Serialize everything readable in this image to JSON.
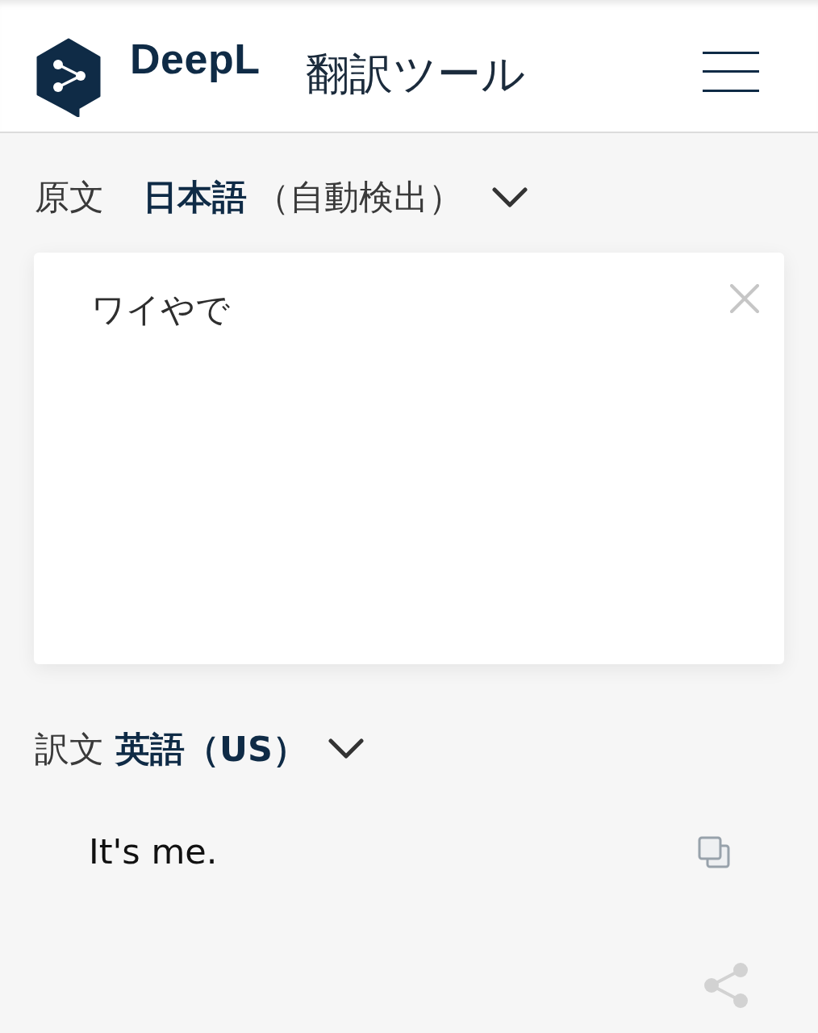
{
  "header": {
    "logo_text": "DeepL",
    "title": "翻訳ツール"
  },
  "source": {
    "label": "原文",
    "language": "日本語",
    "detail": "（自動検出）",
    "text": "ワイやで"
  },
  "target": {
    "label": "訳文",
    "language": "英語（US）",
    "text": "It's me."
  }
}
